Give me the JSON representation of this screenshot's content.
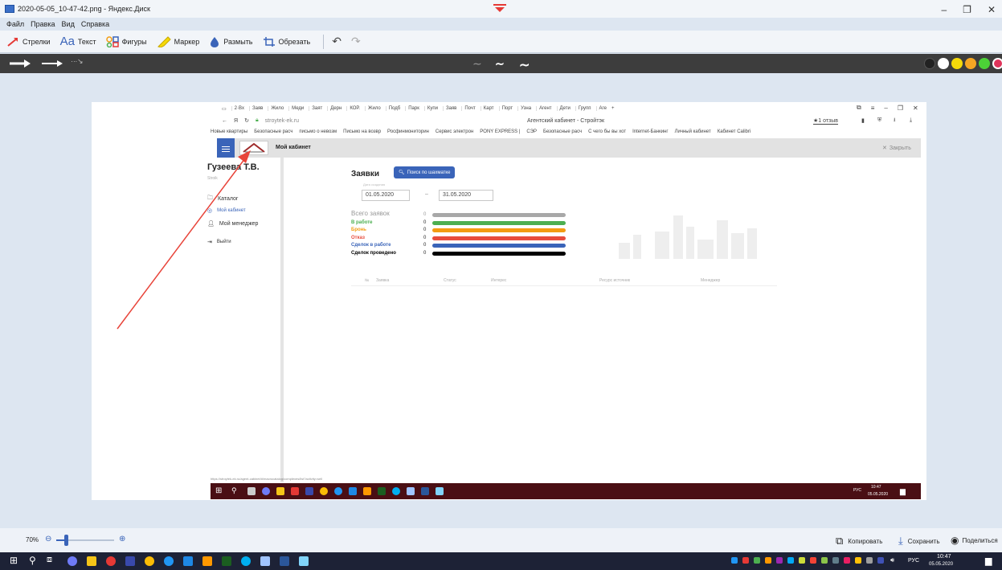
{
  "window": {
    "title": "2020-05-05_10-47-42.png - Яндекс.Диск",
    "menu": [
      "Файл",
      "Правка",
      "Вид",
      "Справка"
    ]
  },
  "toolbar": {
    "arrows": "Стрелки",
    "text": "Текст",
    "shapes": "Фигуры",
    "marker": "Маркер",
    "blur": "Размыть",
    "crop": "Обрезать"
  },
  "colors": {
    "palette": [
      "#222222",
      "#ffffff",
      "#f5d90a",
      "#f5a623",
      "#4cd137",
      "#e0345b",
      "#9b59b6"
    ],
    "arrow": "#e8443a",
    "accent": "#3a64b9"
  },
  "browser": {
    "tabs": [
      "2·Вх",
      "Заяв",
      "Жило",
      "Меди",
      "Заят",
      "Дерн",
      "КОР.",
      "Жило",
      "Подб",
      "Парк",
      "Купи",
      "Заяв",
      "Почт",
      "Карт",
      "Порт",
      "Узна",
      "Агент",
      "Дети",
      "Групп",
      "Аге"
    ],
    "yandex": "Я",
    "url": "stroytek-ek.ru",
    "page_title": "Агентский кабинет - Стройтэк",
    "reviews": "★1 отзыв",
    "bookmarks": [
      "Новые квартиры",
      "Безопасные расч",
      "письмо о невозм",
      "Письмо на возвр",
      "Росфинмониторин",
      "Сервис электрон",
      "PONY EXPRESS |",
      "СЭР",
      "Безопасные расч",
      "С чего бы вы хот",
      "Internet-Банкинг",
      "Личный кабинет",
      "Кабинет Calibri"
    ]
  },
  "app": {
    "cabinet_title": "Мой кабинет",
    "close": "Закрыть",
    "user_name": "Гузеева Т.В.",
    "user_role": "Stroik",
    "nav": [
      "Каталог",
      "Мой кабинет",
      "Мой менеджер",
      "Выйти"
    ],
    "section_title": "Заявки",
    "search_btn": "Поиск по шахматке",
    "date_label": "Дата создания",
    "date_from": "01.05.2020",
    "date_sep": "–",
    "date_to": "31.05.2020",
    "stats": [
      {
        "label": "Всего заявок",
        "count": "0",
        "color": "#a8a8a8",
        "fill": 1.0
      },
      {
        "label": "В работе",
        "count": "0",
        "color": "#4caf50",
        "fill": 1.0
      },
      {
        "label": "Бронь",
        "count": "0",
        "color": "#f39c12",
        "fill": 1.0
      },
      {
        "label": "Отказ",
        "count": "0",
        "color": "#e74c3c",
        "fill": 1.0
      },
      {
        "label": "Сделок в работе",
        "count": "0",
        "color": "#3a64b9",
        "fill": 1.0
      },
      {
        "label": "Сделок проведено",
        "count": "0",
        "color": "#000000",
        "fill": 1.0
      }
    ],
    "table_headers": [
      "№",
      "Заявка",
      "Статус",
      "Интерес",
      "Ресурс источник",
      "Менеджер"
    ],
    "status_url": "https://stroytek-ek.ru/agent-cabinet/#/macrocatalog/complexes/list?activity=sell"
  },
  "inner_taskbar": {
    "lang": "РУС",
    "time": "10:47",
    "date": "05.05.2020"
  },
  "zoom": {
    "level": "70%",
    "value": 0.7,
    "copy": "Копировать",
    "save": "Сохранить",
    "share": "Поделиться"
  },
  "taskbar": {
    "lang": "РУС",
    "time": "10:47",
    "date": "05.05.2020"
  }
}
